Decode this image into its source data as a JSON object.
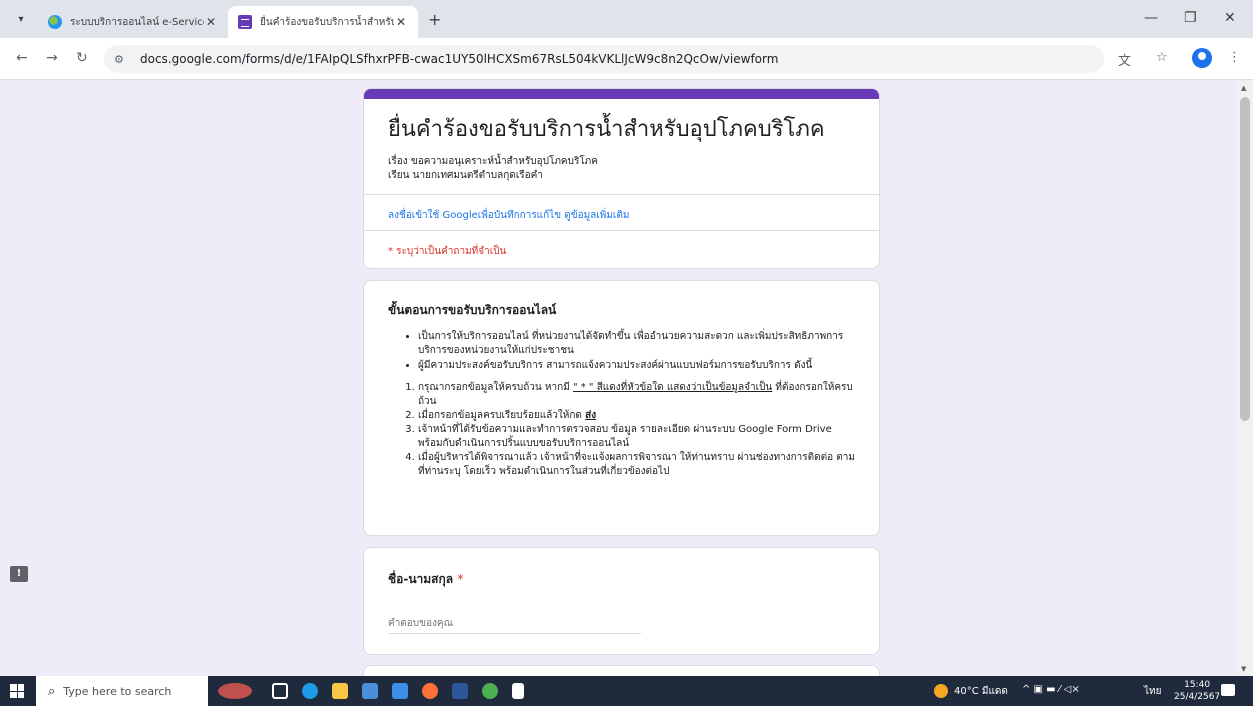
{
  "browser": {
    "tabs": [
      {
        "title": "ระบบบริการออนไลน์ e-Services",
        "icon": "globe-favicon"
      },
      {
        "title": "ยื่นคำร้องขอรับบริการน้ำสำหรับอุปโภ",
        "icon": "google-forms-favicon"
      }
    ],
    "new_tab": "+",
    "url": "docs.google.com/forms/d/e/1FAIpQLSfhxrPFB-cwac1UY50lHCXSm67RsL504kVKLlJcW9c8n2QcOw/viewform"
  },
  "form": {
    "accent_color": "#673ab7",
    "title": "ยื่นคำร้องขอรับบริการน้ำสำหรับอุปโภคบริโภค",
    "desc_line1": "เรื่อง  ขอความอนุเคราะห์น้ำสำหรับอุปโภคบริโภค",
    "desc_line2": "เรียน  นายกเทศมนตรีตำบลกุดเรือคำ",
    "signin_link": "ลงชื่อเข้าใช้ Google",
    "signin_rest": "เพื่อบันทึกการแก้ไข",
    "learn_more": "ดูข้อมูลเพิ่มเติม",
    "required_note": "* ระบุว่าเป็นคำถามที่จำเป็น"
  },
  "steps": {
    "heading": "ขั้นตอนการขอรับบริการออนไลน์",
    "bullets": [
      "เป็นการให้บริการออนไลน์ ที่หน่วยงานได้จัดทำขึ้น เพื่ออำนวยความสะดวก และเพิ่มประสิทธิภาพการบริการของหน่วยงานให้แก่ประชาชน",
      "ผู้มีความประสงค์ขอรับบริการ สามารถแจ้งความประสงค์ผ่านแบบฟอร์มการขอรับบริการ ดังนี้"
    ],
    "step1_a": "กรุณากรอกข้อมูลให้ครบถ้วน หากมี ",
    "step1_u": "\" * \" สีแดงที่หัวข้อใด แสดงว่าเป็นข้อมูลจำเป็น",
    "step1_b": " ที่ต้องกรอกให้ครบถ้วน",
    "step2_a": "เมื่อกรอกข้อมูลครบเรียบร้อยแล้วให้กด ",
    "step2_b": "ส่ง",
    "step3": "เจ้าหน้าที่ได้รับข้อความและทำการตรวจสอบ ข้อมูล รายละเอียด ผ่านระบบ Google Form Drive พร้อมกับดำเนินการปริ้นแบบขอรับบริการออนไลน์",
    "step4": "เมื่อผู้บริหารได้พิจารณาแล้ว เจ้าหน้าที่จะแจ้งผลการพิจารณา ให้ท่านทราบ ผ่านช่องทางการติดต่อ ตามที่ท่านระบุ โดยเร็ว พร้อมดำเนินการในส่วนที่เกี่ยวข้องต่อไป"
  },
  "question": {
    "label": "ชื่อ-นามสกุล",
    "required_mark": "*",
    "placeholder": "คำตอบของคุณ"
  },
  "taskbar": {
    "search_placeholder": "Type here to search",
    "weather": "40°C  มีแดด",
    "lang": "ไทย",
    "time": "15:40",
    "date": "25/4/2567",
    "notification_count": "2"
  }
}
